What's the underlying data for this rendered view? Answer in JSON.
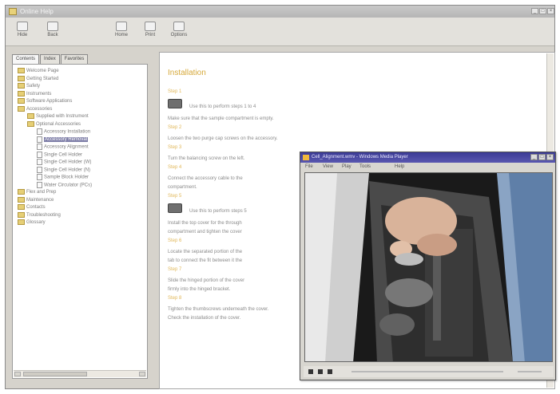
{
  "window": {
    "title": "Online Help",
    "controls": {
      "minimize": "_",
      "maximize": "□",
      "close": "×"
    }
  },
  "toolbar": {
    "buttons": [
      {
        "label": "Hide",
        "icon": "hide-icon"
      },
      {
        "label": "Back",
        "icon": "back-icon"
      },
      {
        "label": "Home",
        "icon": "home-icon"
      },
      {
        "label": "Print",
        "icon": "print-icon"
      },
      {
        "label": "Options",
        "icon": "options-icon"
      }
    ]
  },
  "nav": {
    "tabs": [
      "Contents",
      "Index",
      "Favorites"
    ],
    "active_tab": "Contents",
    "tree": [
      {
        "label": "Welcome Page",
        "type": "folder",
        "level": 0
      },
      {
        "label": "Getting Started",
        "type": "folder",
        "level": 0
      },
      {
        "label": "Safety",
        "type": "folder",
        "level": 0
      },
      {
        "label": "Instruments",
        "type": "folder",
        "level": 0
      },
      {
        "label": "Software Applications",
        "type": "folder",
        "level": 0
      },
      {
        "label": "Accessories",
        "type": "folder",
        "level": 0
      },
      {
        "label": "Supplied with Instrument",
        "type": "folder",
        "level": 1
      },
      {
        "label": "Optional Accessories",
        "type": "folder",
        "level": 1
      },
      {
        "label": "Accessory Installation",
        "type": "page",
        "level": 2
      },
      {
        "label": "Accessory Removal",
        "type": "page",
        "level": 2,
        "selected": true
      },
      {
        "label": "Accessory Alignment",
        "type": "page",
        "level": 2
      },
      {
        "label": "Single Cell Holder",
        "type": "page",
        "level": 2
      },
      {
        "label": "Single Cell Holder (W)",
        "type": "page",
        "level": 2
      },
      {
        "label": "Single Cell Holder (N)",
        "type": "page",
        "level": 2
      },
      {
        "label": "Sample Block Holder",
        "type": "page",
        "level": 2
      },
      {
        "label": "Water Circulator (PCs)",
        "type": "page",
        "level": 2
      },
      {
        "label": "Flex and Prep",
        "type": "folder",
        "level": 0
      },
      {
        "label": "Maintenance",
        "type": "folder",
        "level": 0
      },
      {
        "label": "Contacts",
        "type": "folder",
        "level": 0
      },
      {
        "label": "Troubleshooting",
        "type": "folder",
        "level": 0
      },
      {
        "label": "Glossary",
        "type": "folder",
        "level": 0
      }
    ]
  },
  "content": {
    "title": "Installation",
    "blocks": [
      {
        "step": "Step 1"
      },
      {
        "video": "Use this to perform steps 1 to 4"
      },
      {
        "text": "Make sure that the sample compartment is empty."
      },
      {
        "step": "Step 2"
      },
      {
        "text": "Loosen the two purge cap screws on the accessory."
      },
      {
        "step": "Step 3"
      },
      {
        "text": "Turn the balancing screw on the left."
      },
      {
        "step": "Step 4"
      },
      {
        "text": "Connect the accessory cable to the"
      },
      {
        "text": "compartment."
      },
      {
        "step": "Step 5"
      },
      {
        "video": "Use this to perform steps 5"
      },
      {
        "text": "Install the top cover for the through"
      },
      {
        "text": "compartment and tighten the cover"
      },
      {
        "step": "Step 6"
      },
      {
        "text": "Locate the separated portion of the"
      },
      {
        "text": "tab to connect the fit between it the"
      },
      {
        "step": "Step 7"
      },
      {
        "text": "Slide the hinged portion of the cover"
      },
      {
        "text": "firmly into the hinged bracket."
      },
      {
        "step": "Step 8"
      },
      {
        "text": "Tighten the thumbscrews underneath the cover."
      },
      {
        "text": "Check the installation of the cover."
      }
    ]
  },
  "media_player": {
    "title": "Cell_Alignment.wmv - Windows Media Player",
    "menus": [
      "File",
      "View",
      "Play",
      "Tools",
      "Help"
    ],
    "controls": [
      "play-icon",
      "stop-icon",
      "pause-icon"
    ],
    "controls_close": "×",
    "controls_max": "□",
    "controls_min": "_"
  }
}
